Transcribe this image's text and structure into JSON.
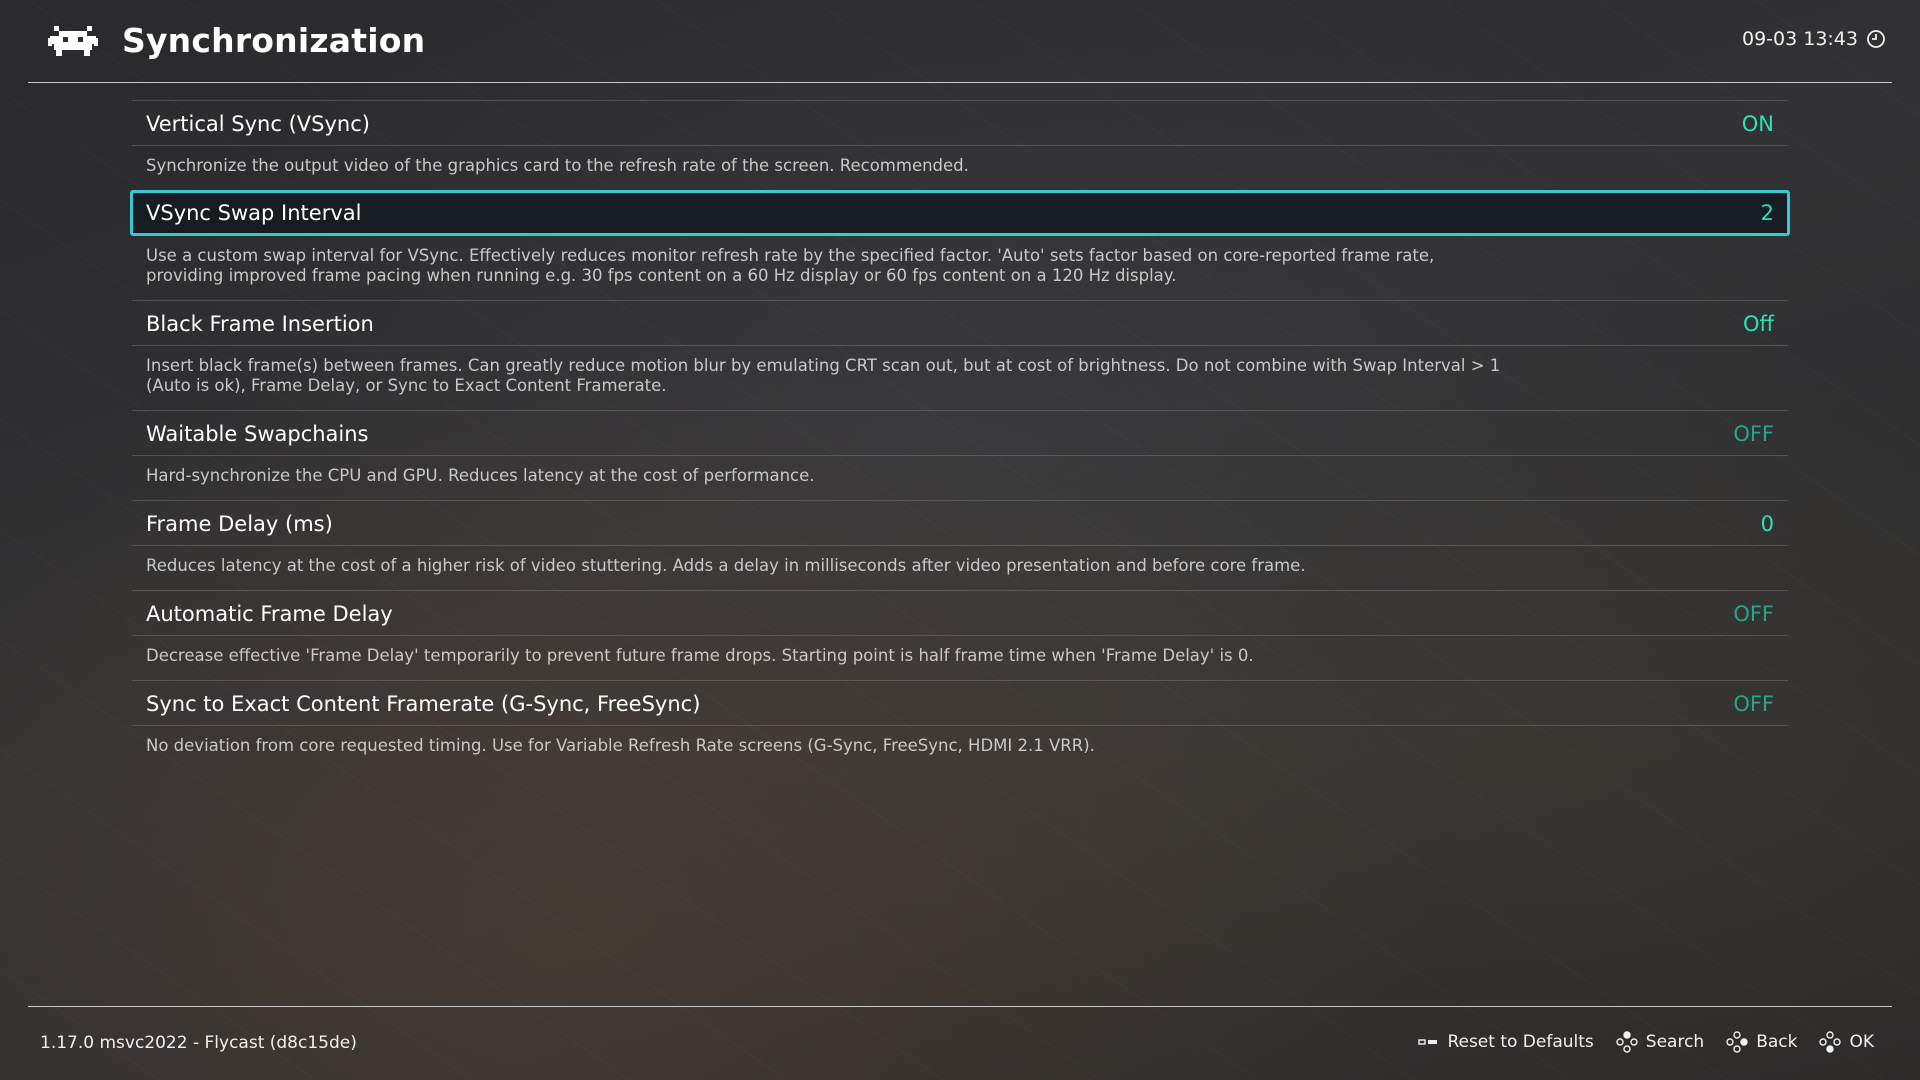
{
  "header": {
    "title": "Synchronization",
    "datetime": "09-03 13:43",
    "logo_icon": "retroarch-invader-icon",
    "clock_icon": "clock-icon"
  },
  "settings": [
    {
      "label": "Vertical Sync (VSync)",
      "value": "ON",
      "description": [
        "Synchronize the output video of the graphics card to the refresh rate of the screen. Recommended."
      ]
    },
    {
      "label": "VSync Swap Interval",
      "value": "2",
      "selected": true,
      "description": [
        "Use a custom swap interval for VSync. Effectively reduces monitor refresh rate by the specified factor. 'Auto' sets factor based on core-reported frame rate,",
        "providing improved frame pacing when running e.g. 30 fps content on a 60 Hz display or 60 fps content on a 120 Hz display."
      ]
    },
    {
      "label": "Black Frame Insertion",
      "value": "Off",
      "description": [
        "Insert black frame(s) between frames. Can greatly reduce motion blur by emulating CRT scan out, but at cost of brightness. Do not combine with Swap Interval > 1",
        "(Auto is ok), Frame Delay, or Sync to Exact Content Framerate."
      ]
    },
    {
      "label": "Waitable Swapchains",
      "value": "OFF",
      "description": [
        "Hard-synchronize the CPU and GPU. Reduces latency at the cost of performance."
      ]
    },
    {
      "label": "Frame Delay (ms)",
      "value": "0",
      "description": [
        "Reduces latency at the cost of a higher risk of video stuttering. Adds a delay in milliseconds after video presentation and before core frame."
      ]
    },
    {
      "label": "Automatic Frame Delay",
      "value": "OFF",
      "description": [
        "Decrease effective 'Frame Delay' temporarily to prevent future frame drops. Starting point is half frame time when 'Frame Delay' is 0."
      ]
    },
    {
      "label": "Sync to Exact Content Framerate (G-Sync, FreeSync)",
      "value": "OFF",
      "description": [
        "No deviation from core requested timing. Use for Variable Refresh Rate screens (G-Sync, FreeSync, HDMI 2.1 VRR)."
      ]
    }
  ],
  "footer": {
    "version": "1.17.0 msvc2022 - Flycast (d8c15de)",
    "actions": {
      "reset": "Reset to Defaults",
      "search": "Search",
      "back": "Back",
      "ok": "OK"
    }
  },
  "colors": {
    "accent": "#35c9d4",
    "value_on": "#2ee0b5",
    "value_off": "#26a58a"
  }
}
